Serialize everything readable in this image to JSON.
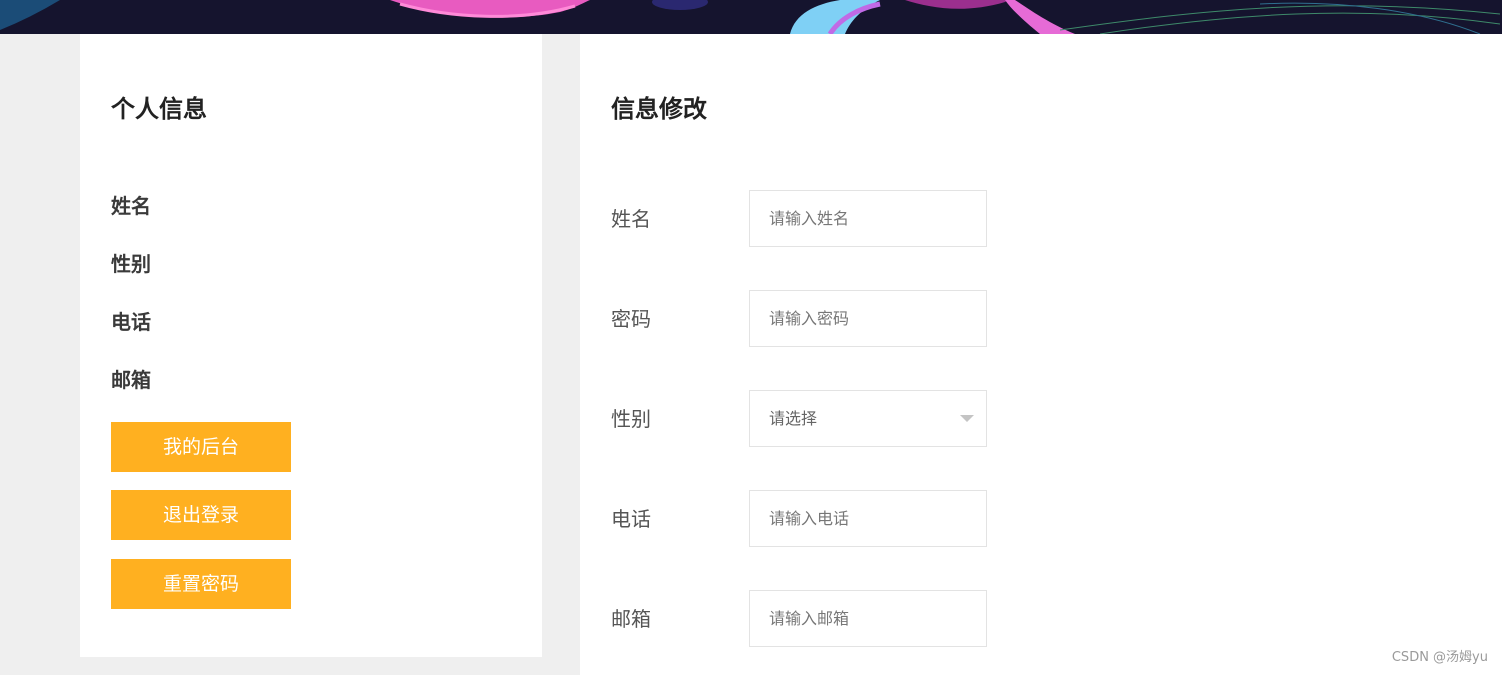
{
  "left_panel": {
    "title": "个人信息",
    "fields": [
      "姓名",
      "性别",
      "电话",
      "邮箱"
    ],
    "buttons": {
      "backend": "我的后台",
      "logout": "退出登录",
      "reset_password": "重置密码"
    }
  },
  "right_panel": {
    "title": "信息修改",
    "form": {
      "name": {
        "label": "姓名",
        "placeholder": "请输入姓名"
      },
      "password": {
        "label": "密码",
        "placeholder": "请输入密码"
      },
      "gender": {
        "label": "性别",
        "selected": "请选择"
      },
      "phone": {
        "label": "电话",
        "placeholder": "请输入电话"
      },
      "email": {
        "label": "邮箱",
        "placeholder": "请输入邮箱"
      }
    }
  },
  "watermark": "CSDN @汤姆yu",
  "colors": {
    "accent_button": "#ffb020",
    "banner_bg": "#15142e",
    "page_bg": "#efefef"
  }
}
